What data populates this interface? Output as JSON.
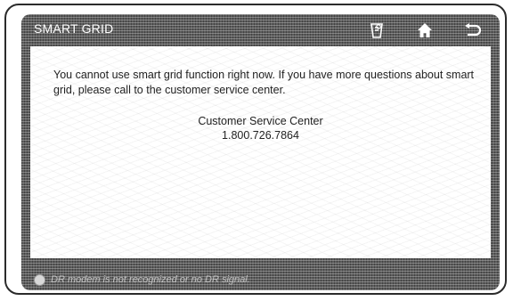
{
  "header": {
    "title": "SMART GRID",
    "icons": [
      "settings-icon",
      "home-icon",
      "back-icon"
    ]
  },
  "content": {
    "message": "You cannot use smart grid function right now. If you have more questions about smart grid, please call to the customer service center.",
    "contact_label": "Customer Service Center",
    "contact_number": "1.800.726.7864"
  },
  "status": {
    "text": "DR modem is not recognized or no DR signal."
  },
  "colors": {
    "screen_background": "#5c5c5c",
    "panel_background": "#ffffff",
    "header_text": "#ffffff",
    "body_text": "#222222"
  }
}
